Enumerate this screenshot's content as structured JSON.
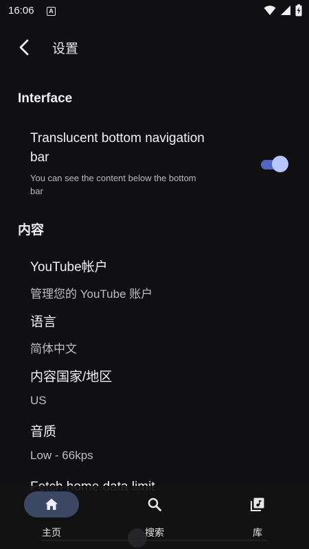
{
  "status_bar": {
    "time": "16:06",
    "notification": "A"
  },
  "app_bar": {
    "title": "设置"
  },
  "sections": {
    "interface": {
      "title": "Interface",
      "translucent": {
        "title_line1": "Translucent bottom navigation",
        "title_line2": "bar",
        "desc_line1": "You can see the content below the bottom",
        "desc_line2": "bar",
        "enabled": true
      }
    },
    "content": {
      "title": "内容",
      "items": [
        {
          "title": "YouTube帐户",
          "subtitle": "管理您的 YouTube 账户"
        },
        {
          "title": "语言",
          "subtitle": "简体中文"
        },
        {
          "title": "内容国家/地区",
          "subtitle": "US"
        },
        {
          "title": "音质",
          "subtitle": "Low - 66kps"
        },
        {
          "title": "Fetch home data limit"
        }
      ]
    }
  },
  "bottom_nav": {
    "items": [
      {
        "label": "主页",
        "icon": "home-icon",
        "active": true
      },
      {
        "label": "搜索",
        "icon": "search-icon",
        "active": false
      },
      {
        "label": "库",
        "icon": "library-music-icon",
        "active": false
      }
    ]
  },
  "colors": {
    "accent": "#4f66c4",
    "accent_light": "#b9c5ff",
    "background": "#101012"
  }
}
